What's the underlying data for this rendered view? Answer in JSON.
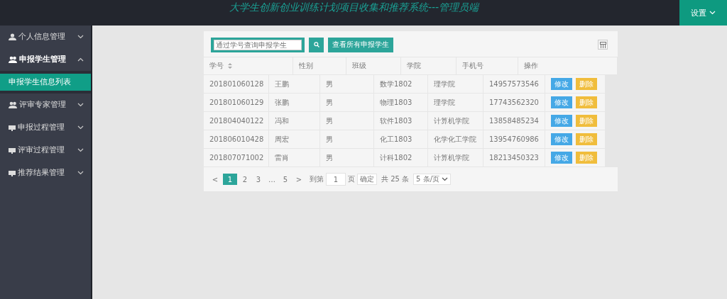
{
  "header": {
    "title": "大学生创新创业训练计划项目收集和推荐系统---管理员端",
    "settings": "设置"
  },
  "sidebar": {
    "items": [
      {
        "label": "个人信息管理",
        "expanded": false
      },
      {
        "label": "申报学生管理",
        "expanded": true,
        "children": [
          {
            "label": "申报学生信息列表",
            "selected": true
          }
        ]
      },
      {
        "label": "评审专家管理",
        "expanded": false
      },
      {
        "label": "申报过程管理",
        "expanded": false
      },
      {
        "label": "评审过程管理",
        "expanded": false
      },
      {
        "label": "推荐结果管理",
        "expanded": false
      }
    ]
  },
  "toolbar": {
    "search": {
      "placeholder": "通过学号查询申报学生"
    },
    "view_all": "查看所有申报学生"
  },
  "table": {
    "columns": [
      {
        "label": "学号",
        "sortable": true
      },
      {
        "label": "性别",
        "sortable": false
      },
      {
        "label": "班级",
        "sortable": false
      },
      {
        "label": "学院",
        "sortable": false
      },
      {
        "label": "手机号",
        "sortable": false
      },
      {
        "label": "操作",
        "sortable": false
      }
    ],
    "rows": [
      {
        "cells": [
          "201801060128",
          "王鹏",
          "男",
          "数学1802",
          "理学院",
          "14957573546"
        ],
        "actions": [
          "修改",
          "删除"
        ]
      },
      {
        "cells": [
          "201801060129",
          "张鹏",
          "男",
          "物理1803",
          "理学院",
          "17743562320"
        ],
        "actions": [
          "修改",
          "删除"
        ]
      },
      {
        "cells": [
          "201804040122",
          "冯和",
          "男",
          "软件1803",
          "计算机学院",
          "13858485234"
        ],
        "actions": [
          "修改",
          "删除"
        ]
      },
      {
        "cells": [
          "201806010428",
          "周宏",
          "男",
          "化工1803",
          "化学化工学院",
          "13954760986"
        ],
        "actions": [
          "修改",
          "删除"
        ]
      },
      {
        "cells": [
          "201807071002",
          "雷肖",
          "男",
          "计科1802",
          "计算机学院",
          "18213450323"
        ],
        "actions": [
          "修改",
          "删除"
        ]
      }
    ]
  },
  "pager": {
    "prev": "<",
    "pages": [
      {
        "label": "1",
        "selected": true
      },
      {
        "label": "2",
        "selected": false
      },
      {
        "label": "3",
        "selected": false
      },
      {
        "label": "…",
        "selected": false
      },
      {
        "label": "5",
        "selected": false
      }
    ],
    "next": ">",
    "goto_label": "到第",
    "page_input": "1",
    "page_unit": "页",
    "confirm": "确定",
    "total": "共 25 条",
    "page_size": "5 条/页"
  }
}
